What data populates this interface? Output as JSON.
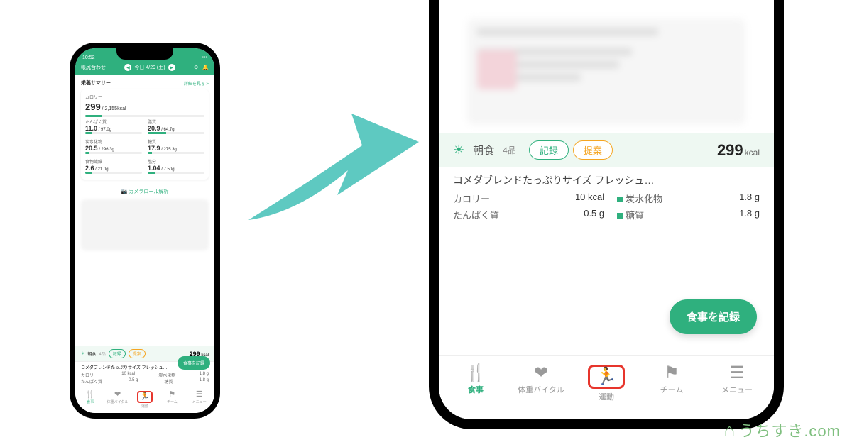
{
  "status_time": "10:52",
  "header": {
    "left": "帳尻合わせ",
    "date": "今日 4/29 (土)"
  },
  "summary": {
    "title": "栄養サマリー",
    "more": "詳細を見る >"
  },
  "calorie": {
    "label": "カロリー",
    "value": "299",
    "target": "/ 2,155kcal"
  },
  "nutrients": [
    {
      "label": "たんぱく質",
      "value": "11.0",
      "target": "/ 97.0g",
      "pct": 11
    },
    {
      "label": "脂質",
      "value": "20.9",
      "target": "/ 64.7g",
      "pct": 32
    },
    {
      "label": "炭水化物",
      "value": "20.5",
      "target": "/ 296.3g",
      "pct": 7
    },
    {
      "label": "糖質",
      "value": "17.9",
      "target": "/ 275.3g",
      "pct": 7
    },
    {
      "label": "食物繊維",
      "value": "2.6",
      "target": "/ 21.0g",
      "pct": 12
    },
    {
      "label": "塩分",
      "value": "1.04",
      "target": "/ 7.50g",
      "pct": 14
    }
  ],
  "camera_roll": "カメラロール解析",
  "meal": {
    "name": "朝食",
    "count": "4品",
    "record_btn": "記録",
    "suggest_btn": "提案",
    "kcal_value": "299",
    "kcal_unit": "kcal"
  },
  "item": {
    "title": "コメダブレンドたっぷりサイズ フレッシュ…",
    "rows": [
      {
        "k": "カロリー",
        "v": "10 kcal"
      },
      {
        "k": "炭水化物",
        "v": "1.8 g"
      },
      {
        "k": "たんぱく質",
        "v": "0.5 g"
      },
      {
        "k": "糖質",
        "v": "1.8 g"
      }
    ]
  },
  "fab": "食事を記録",
  "tabs": [
    {
      "label": "食事",
      "icon": "🍴"
    },
    {
      "label": "体重バイタル",
      "icon": "❤"
    },
    {
      "label": "運動",
      "icon": "🏃"
    },
    {
      "label": "チーム",
      "icon": "⚑"
    },
    {
      "label": "メニュー",
      "icon": "☰"
    }
  ],
  "watermark": "うちすき.com"
}
